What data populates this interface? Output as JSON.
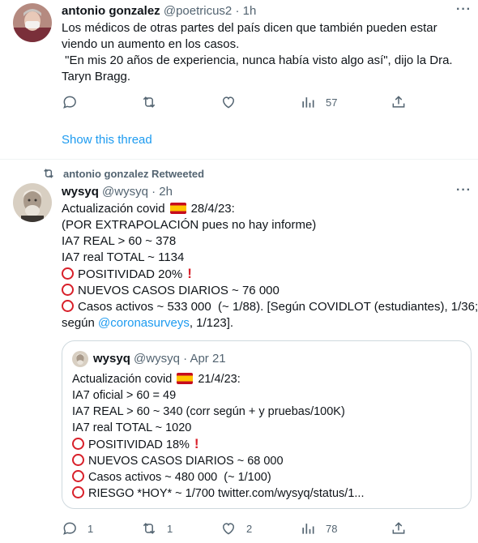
{
  "tweet1": {
    "author_name": "antonio gonzalez",
    "author_handle": "@poetricus2",
    "separator": "·",
    "time": "1h",
    "more_icon": "more-icon",
    "lines": [
      "Los médicos de otras partes del país dicen que también pueden estar",
      "viendo un aumento en los casos.",
      " \"En mis 20 años de experiencia, nunca había visto algo así\", dijo la Dra.",
      "Taryn Bragg."
    ],
    "actions": {
      "reply_count": "",
      "retweet_count": "",
      "like_count": "",
      "views_count": "57"
    },
    "show_thread": "Show this thread"
  },
  "retweet_banner": {
    "text": "antonio gonzalez Retweeted",
    "icon": "retweet-icon"
  },
  "tweet2": {
    "author_name": "wysyq",
    "author_handle": "@wysyq",
    "separator": "·",
    "time": "2h",
    "line1_text": "Actualización covid",
    "line1_date": "28/4/23:",
    "line2": "(POR EXTRAPOLACIÓN pues no hay informe)",
    "line3": "IA7 REAL > 60 ~ 378",
    "line4": "IA7 real TOTAL ~ 1134",
    "line5": "POSITIVIDAD 20%",
    "line6": "NUEVOS CASOS DIARIOS ~ 76 000",
    "line7": "Casos activos ~ 533 000  (~ 1/88). [Según COVIDLOT (estudiantes), 1/36;",
    "line8_prefix": "según ",
    "line8_link": "@coronasurveys",
    "line8_suffix": ", 1/123].",
    "actions": {
      "reply_count": "1",
      "retweet_count": "1",
      "like_count": "2",
      "views_count": "78"
    }
  },
  "quote": {
    "author_name": "wysyq",
    "author_handle": "@wysyq",
    "separator": "·",
    "date": "Apr 21",
    "line1_text": "Actualización covid",
    "line1_date": "21/4/23:",
    "line2": "IA7 oficial > 60 = 49",
    "line3": "IA7 REAL > 60 ~ 340 (corr según + y pruebas/100K)",
    "line4": "IA7 real TOTAL ~ 1020",
    "line5": "POSITIVIDAD 18%",
    "line6": "NUEVOS CASOS DIARIOS ~ 68 000",
    "line7": "Casos activos ~ 480 000  (~ 1/100)",
    "line8": "RIESGO *HOY* ~ 1/700 twitter.com/wysyq/status/1..."
  },
  "colors": {
    "accent": "#1d9bf0",
    "secondary_text": "#536471",
    "alert_red": "#d8202a",
    "border": "#cfd9de"
  }
}
